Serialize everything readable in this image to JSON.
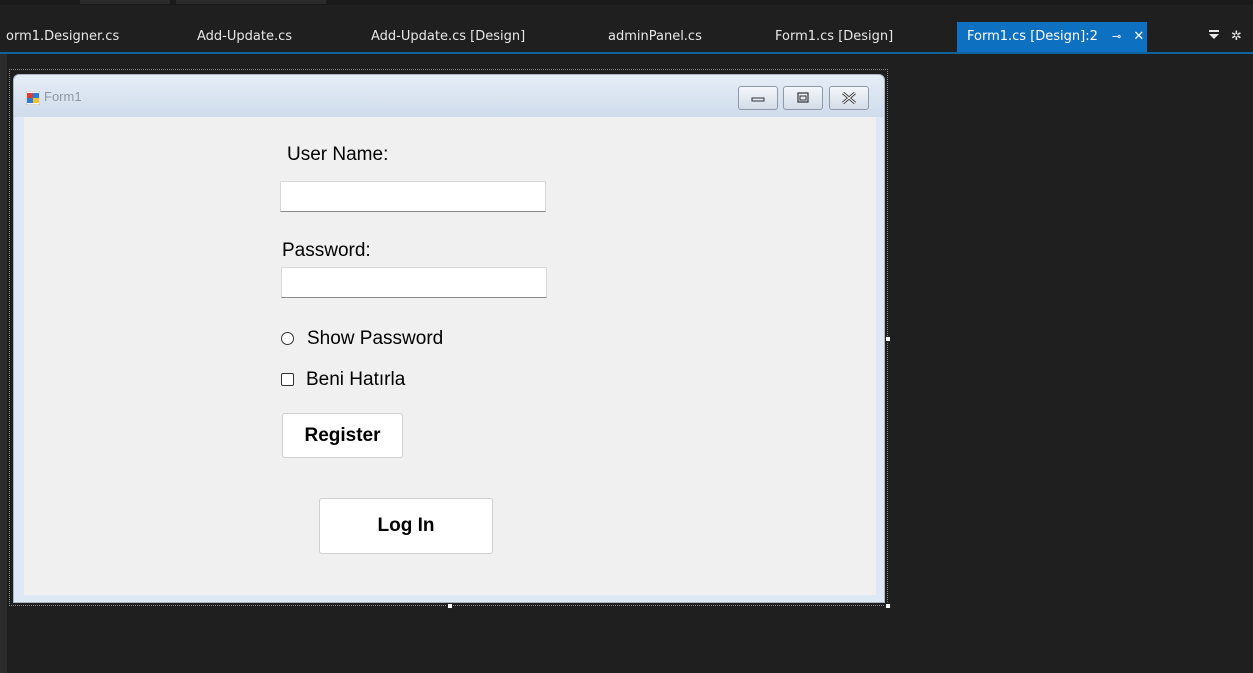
{
  "tabs": [
    {
      "label": "orm1.Designer.cs"
    },
    {
      "label": "Add-Update.cs"
    },
    {
      "label": "Add-Update.cs [Design]"
    },
    {
      "label": "adminPanel.cs"
    },
    {
      "label": "Form1.cs [Design]"
    },
    {
      "label": "Form1.cs [Design]:2",
      "active": true
    }
  ],
  "tab_controls": {
    "pin_icon": "pin-icon",
    "close_icon": "close-icon",
    "dropdown_icon": "dropdown-icon",
    "settings_icon": "gear-icon"
  },
  "form": {
    "title": "Form1",
    "username_label": "User Name:",
    "username_value": "",
    "password_label": "Password:",
    "password_value": "",
    "show_password_label": "Show Password",
    "remember_label": "Beni Hatırla",
    "register_label": "Register",
    "login_label": "Log In"
  },
  "colors": {
    "active_tab": "#0e70c0",
    "editor_bg": "#1f1f1f",
    "form_bg": "#f0f0f0"
  }
}
